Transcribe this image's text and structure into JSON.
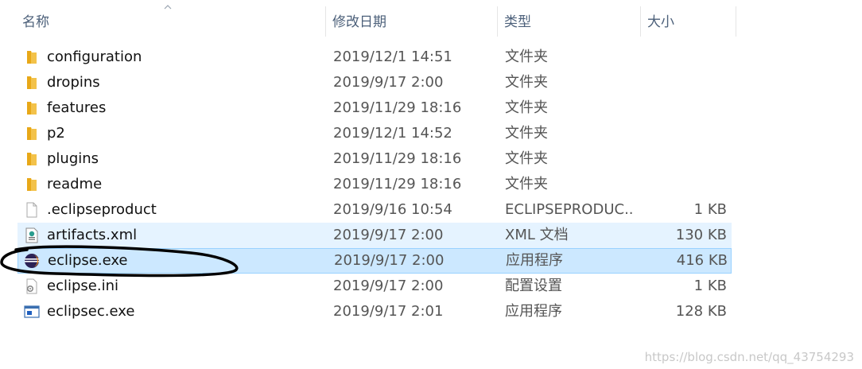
{
  "columns": {
    "name": "名称",
    "date": "修改日期",
    "type": "类型",
    "size": "大小"
  },
  "files": [
    {
      "name": "configuration",
      "date": "2019/12/1 14:51",
      "type": "文件夹",
      "size": "",
      "icon": "folder-icon"
    },
    {
      "name": "dropins",
      "date": "2019/9/17 2:00",
      "type": "文件夹",
      "size": "",
      "icon": "folder-icon"
    },
    {
      "name": "features",
      "date": "2019/11/29 18:16",
      "type": "文件夹",
      "size": "",
      "icon": "folder-icon"
    },
    {
      "name": "p2",
      "date": "2019/12/1 14:52",
      "type": "文件夹",
      "size": "",
      "icon": "folder-icon"
    },
    {
      "name": "plugins",
      "date": "2019/11/29 18:16",
      "type": "文件夹",
      "size": "",
      "icon": "folder-icon"
    },
    {
      "name": "readme",
      "date": "2019/11/29 18:16",
      "type": "文件夹",
      "size": "",
      "icon": "folder-icon"
    },
    {
      "name": ".eclipseproduct",
      "date": "2019/9/16 10:54",
      "type": "ECLIPSEPRODUC...",
      "size": "1 KB",
      "icon": "blank-file-icon"
    },
    {
      "name": "artifacts.xml",
      "date": "2019/9/17 2:00",
      "type": "XML 文档",
      "size": "130 KB",
      "icon": "xml-file-icon"
    },
    {
      "name": "eclipse.exe",
      "date": "2019/9/17 2:00",
      "type": "应用程序",
      "size": "416 KB",
      "icon": "eclipse-app-icon"
    },
    {
      "name": "eclipse.ini",
      "date": "2019/9/17 2:00",
      "type": "配置设置",
      "size": "1 KB",
      "icon": "settings-file-icon"
    },
    {
      "name": "eclipsec.exe",
      "date": "2019/9/17 2:01",
      "type": "应用程序",
      "size": "128 KB",
      "icon": "console-app-icon"
    }
  ],
  "watermark": "https://blog.csdn.net/qq_43754293"
}
